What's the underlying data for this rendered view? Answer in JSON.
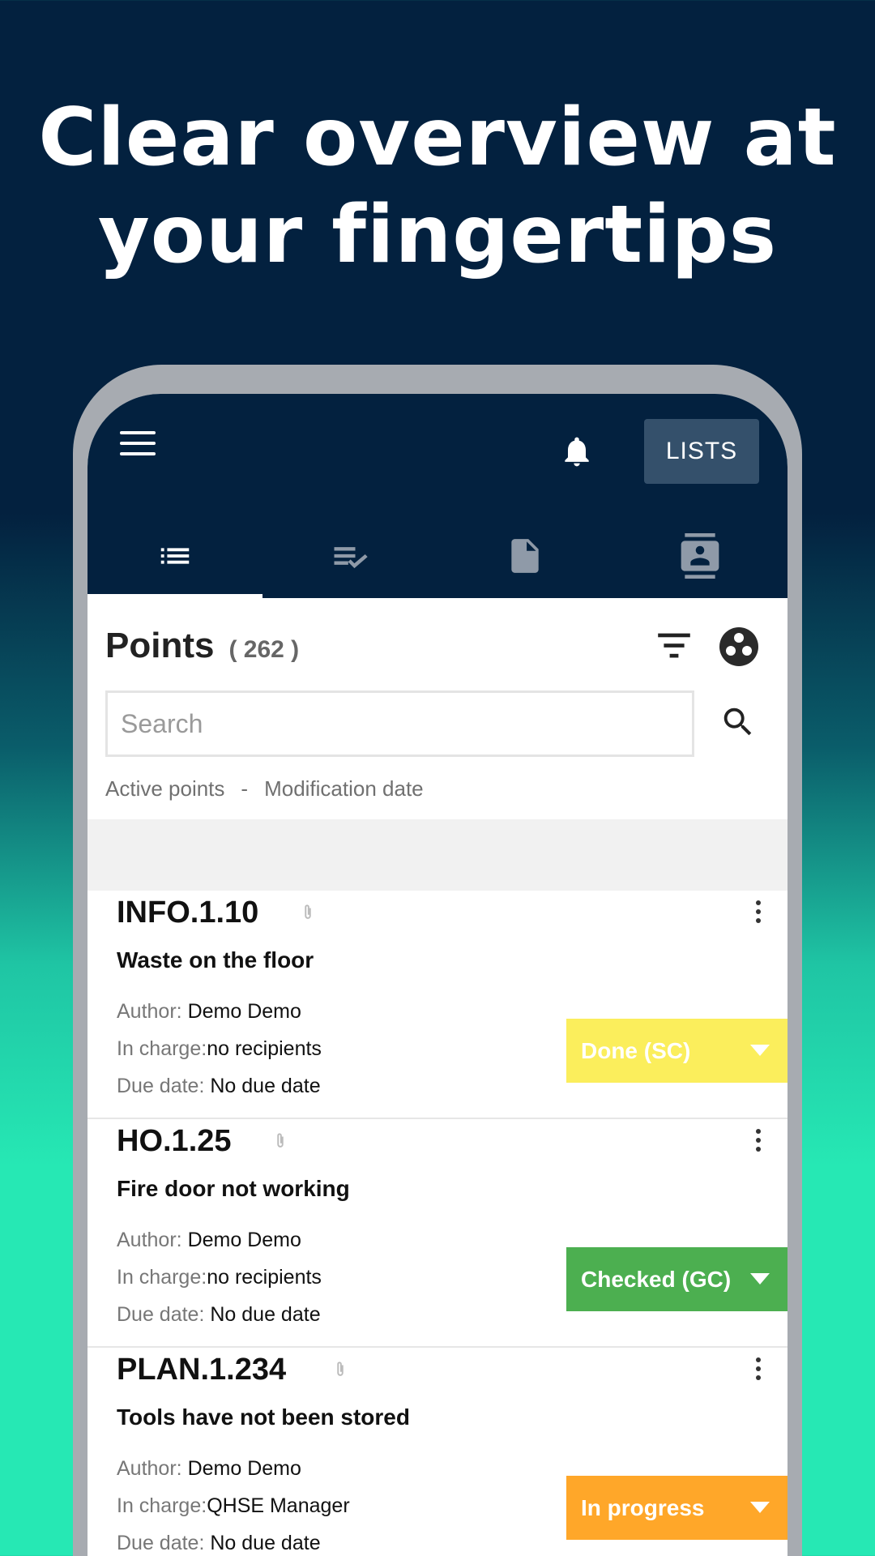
{
  "promo": {
    "line1": "Clear overview at",
    "line2": "your fingertips"
  },
  "toolbar": {
    "lists_label": "LISTS"
  },
  "points": {
    "title": "Points",
    "count": "( 262 )"
  },
  "search": {
    "placeholder": "Search"
  },
  "filters": {
    "state": "Active points",
    "separator": "-",
    "sort": "Modification date"
  },
  "labels": {
    "author": "Author:",
    "in_charge": "In charge:",
    "due_date": "Due date:"
  },
  "cards": [
    {
      "id": "INFO.1.10",
      "title": "Waste on the floor",
      "author": "Demo Demo",
      "in_charge": "no recipients",
      "due": "No due date",
      "status": "Done (SC)",
      "status_color": "#fbee5c"
    },
    {
      "id": "HO.1.25",
      "title": "Fire door not working",
      "author": "Demo Demo",
      "in_charge": "no recipients",
      "due": "No due date",
      "status": "Checked (GC)",
      "status_color": "#4caf50"
    },
    {
      "id": "PLAN.1.234",
      "title": "Tools have not been stored",
      "author": "Demo Demo",
      "in_charge": "QHSE Manager",
      "due": "No due date",
      "status": "In progress",
      "status_color": "#ffa729"
    }
  ],
  "colors": {
    "header_bg": "#03213f",
    "lists_button_bg": "#34506b",
    "accent_gradient_end": "#26e8b4"
  },
  "icons": {
    "menu": "hamburger-menu-icon",
    "bell": "bell-icon",
    "tab1": "list-icon",
    "tab2": "checklist-icon",
    "tab3": "document-icon",
    "tab4": "contacts-icon",
    "filter": "filter-icon",
    "group": "group-icon",
    "search": "search-icon",
    "attachment": "paperclip-icon",
    "more": "more-vertical-icon"
  }
}
